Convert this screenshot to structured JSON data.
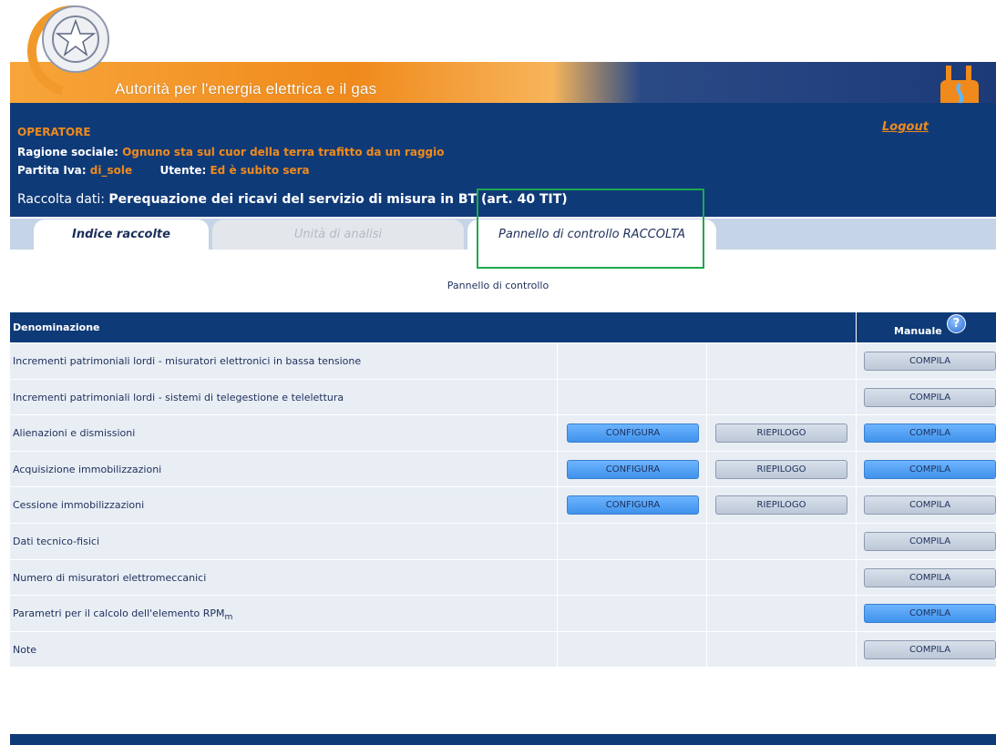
{
  "header": {
    "agency_title": "Autorità per l'energia elettrica e il gas",
    "logout_label": "Logout"
  },
  "operator": {
    "heading": "OPERATORE",
    "ragione_label": "Ragione sociale:",
    "ragione_value": "Ognuno sta sul cuor della terra trafitto da un raggio",
    "piva_label": "Partita Iva:",
    "piva_value": "di_sole",
    "utente_label": "Utente:",
    "utente_value": "Ed è subito sera"
  },
  "raccolta": {
    "label": "Raccolta dati:",
    "value": "Perequazione dei ricavi del servizio di misura in BT (art. 40 TIT)"
  },
  "tabs": [
    {
      "label": "Indice raccolte",
      "state": "normal"
    },
    {
      "label": "Unità di analisi",
      "state": "disabled"
    },
    {
      "label": "Pannello di controllo RACCOLTA",
      "state": "active"
    }
  ],
  "page_subtitle": "Pannello di controllo",
  "table": {
    "col_name": "Denominazione",
    "col_manual": "Manuale",
    "help_glyph": "?",
    "rows": [
      {
        "name": "Incrementi patrimoniali lordi - misuratori elettronici in bassa tensione",
        "configura": null,
        "riepilogo": null,
        "compila": "COMPILA",
        "compila_style": "gray"
      },
      {
        "name": "Incrementi patrimoniali lordi - sistemi di telegestione e telelettura",
        "configura": null,
        "riepilogo": null,
        "compila": "COMPILA",
        "compila_style": "gray"
      },
      {
        "name": "Alienazioni e dismissioni",
        "configura": "CONFIGURA",
        "riepilogo": "RIEPILOGO",
        "compila": "COMPILA",
        "compila_style": "blue"
      },
      {
        "name": "Acquisizione immobilizzazioni",
        "configura": "CONFIGURA",
        "riepilogo": "RIEPILOGO",
        "compila": "COMPILA",
        "compila_style": "blue"
      },
      {
        "name": "Cessione immobilizzazioni",
        "configura": "CONFIGURA",
        "riepilogo": "RIEPILOGO",
        "compila": "COMPILA",
        "compila_style": "gray"
      },
      {
        "name": "Dati tecnico-fisici",
        "configura": null,
        "riepilogo": null,
        "compila": "COMPILA",
        "compila_style": "gray"
      },
      {
        "name": "Numero di misuratori elettromeccanici",
        "configura": null,
        "riepilogo": null,
        "compila": "COMPILA",
        "compila_style": "gray"
      },
      {
        "name": "Parametri per il calcolo dell'elemento RPM",
        "name_sub": "m",
        "configura": null,
        "riepilogo": null,
        "compila": "COMPILA",
        "compila_style": "blue"
      },
      {
        "name": "Note",
        "configura": null,
        "riepilogo": null,
        "compila": "COMPILA",
        "compila_style": "gray"
      }
    ]
  },
  "colors": {
    "navy": "#0f3a78",
    "orange": "#f08a1c",
    "highlight_border": "#1fa84d"
  }
}
